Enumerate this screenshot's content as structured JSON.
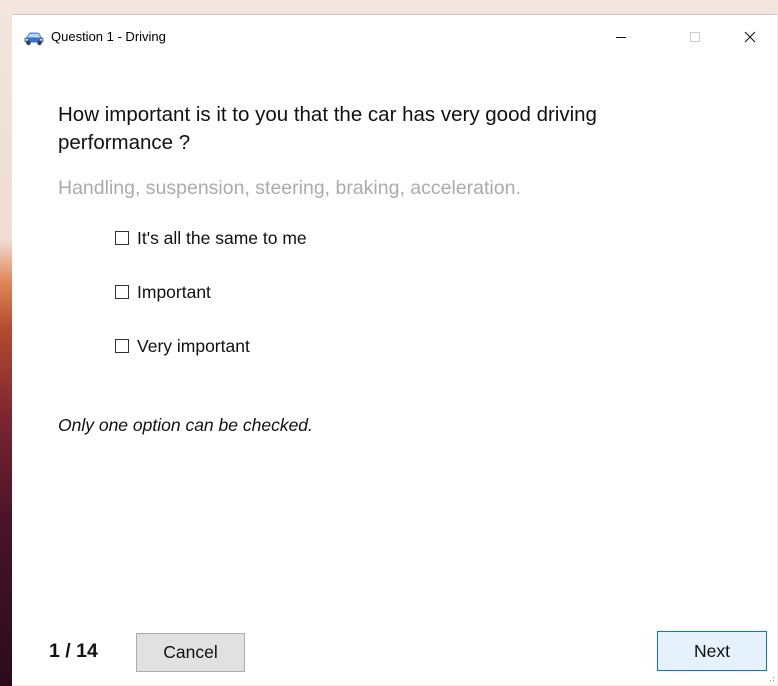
{
  "window": {
    "title": "Question 1 - Driving",
    "icon": "car-icon",
    "controls": [
      "minimize-icon",
      "maximize-icon",
      "close-icon"
    ]
  },
  "question": {
    "text": "How important is it to you that the car has very good driving performance ?",
    "subtitle": "Handling, suspension, steering, braking, acceleration."
  },
  "options": [
    {
      "label": "It's all the same to me",
      "checked": false
    },
    {
      "label": "Important",
      "checked": false
    },
    {
      "label": "Very important",
      "checked": false
    }
  ],
  "hint": "Only one option can be checked.",
  "footer": {
    "counter": "1 / 14",
    "cancel_label": "Cancel",
    "next_label": "Next"
  },
  "colors": {
    "accent": "#0078d7",
    "subtitle": "#ababab",
    "button_bg": "#e1e1e1"
  }
}
